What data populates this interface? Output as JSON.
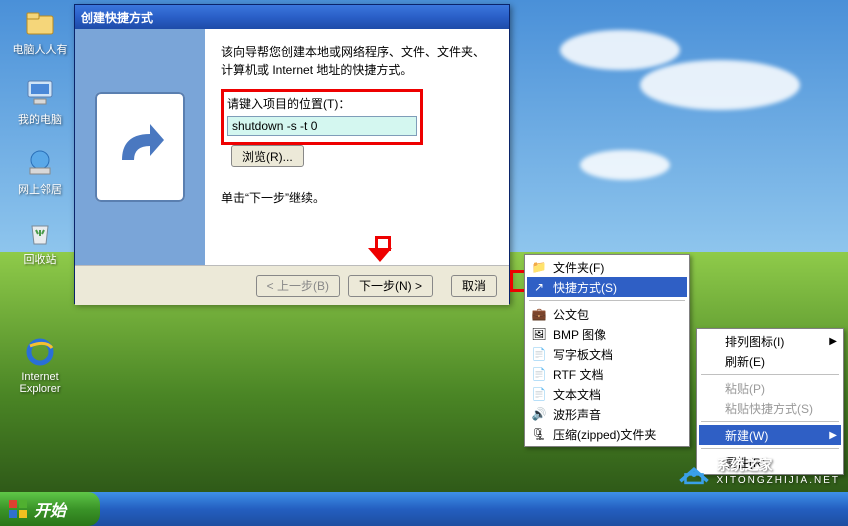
{
  "desktop": {
    "icons": [
      {
        "label": "电脑人人有"
      },
      {
        "label": "我的电脑"
      },
      {
        "label": "网上邻居"
      },
      {
        "label": "回收站"
      },
      {
        "label": "Internet\nExplorer"
      }
    ]
  },
  "wizard": {
    "title": "创建快捷方式",
    "intro": "该向导帮您创建本地或网络程序、文件、文件夹、计算机或 Internet 地址的快捷方式。",
    "location_label": "请键入项目的位置(T)：",
    "location_value": "shutdown -s -t 0",
    "browse": "浏览(R)...",
    "continue_hint": "单击“下一步”继续。",
    "back": "< 上一步(B)",
    "next": "下一步(N) >",
    "cancel": "取消"
  },
  "submenu": {
    "items": [
      {
        "icon": "folder-icon",
        "label": "文件夹(F)"
      },
      {
        "icon": "shortcut-icon",
        "label": "快捷方式(S)",
        "highlight": true
      },
      {
        "icon": "briefcase-icon",
        "label": "公文包"
      },
      {
        "icon": "bmp-icon",
        "label": "BMP 图像"
      },
      {
        "icon": "wordpad-icon",
        "label": "写字板文档"
      },
      {
        "icon": "rtf-icon",
        "label": "RTF 文档"
      },
      {
        "icon": "txt-icon",
        "label": "文本文档"
      },
      {
        "icon": "wav-icon",
        "label": "波形声音"
      },
      {
        "icon": "zip-icon",
        "label": "压缩(zipped)文件夹"
      }
    ]
  },
  "context_menu": {
    "arrange": "排列图标(I)",
    "refresh": "刷新(E)",
    "paste": "粘贴(P)",
    "paste_shortcut": "粘贴快捷方式(S)",
    "new": "新建(W)",
    "properties": "属性(R)"
  },
  "taskbar": {
    "start": "开始"
  },
  "watermark": {
    "brand": "系统之家",
    "sub": "XITONGZHIJIA.NET"
  }
}
